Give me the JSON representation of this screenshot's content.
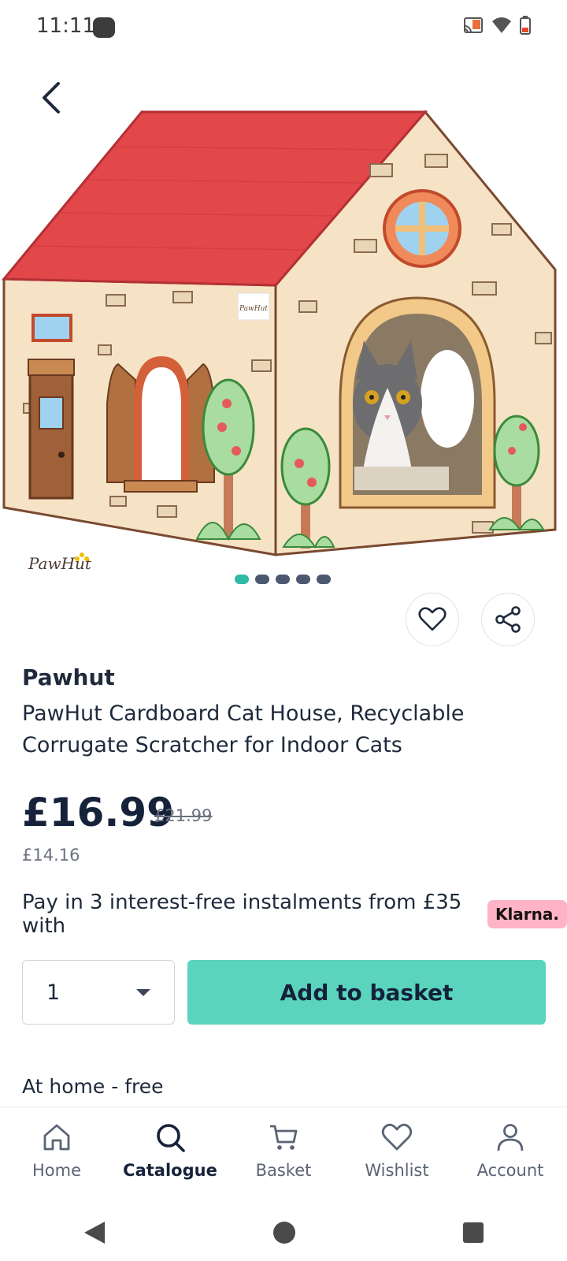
{
  "status_bar": {
    "time": "11:11"
  },
  "product": {
    "brand": "Pawhut",
    "title": "PawHut Cardboard Cat House, Recyclable Corrugate Scratcher for Indoor Cats",
    "price": "£16.99",
    "old_price": "£21.99",
    "ex_vat_price": "£14.16",
    "image_logo": "PawHut",
    "carousel": {
      "count": 5,
      "active": 1
    }
  },
  "klarna": {
    "text": "Pay in 3 interest-free instalments from £35 with",
    "badge": "Klarna."
  },
  "purchase": {
    "quantity": "1",
    "add_label": "Add to basket"
  },
  "delivery": {
    "text": "At home - free"
  },
  "bottom_nav": [
    {
      "label": "Home",
      "icon": "home-icon"
    },
    {
      "label": "Catalogue",
      "icon": "search-icon",
      "active": true
    },
    {
      "label": "Basket",
      "icon": "cart-icon"
    },
    {
      "label": "Wishlist",
      "icon": "heart-icon"
    },
    {
      "label": "Account",
      "icon": "account-icon"
    }
  ],
  "colors": {
    "accent": "#5ad4bd",
    "active_dot": "#2fb9a6",
    "klarna": "#ffb3c7",
    "text": "#1e2a3b"
  }
}
